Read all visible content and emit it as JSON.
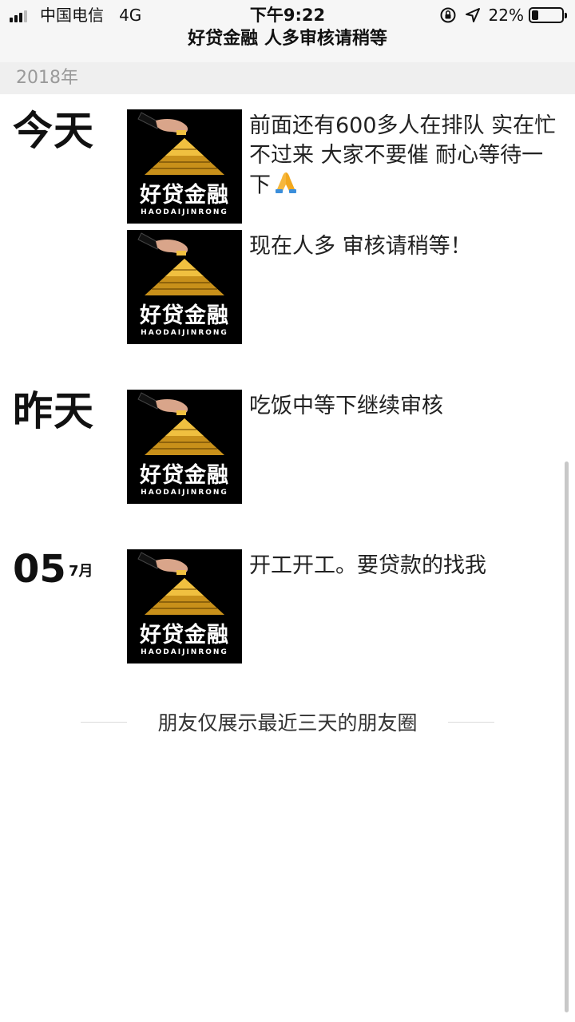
{
  "status_bar": {
    "carrier": "中国电信",
    "network": "4G",
    "time": "下午9:22",
    "battery_percent_text": "22%",
    "battery_level": 0.22,
    "icons": [
      "signal-icon",
      "orientation-lock-icon",
      "location-arrow-icon",
      "battery-icon"
    ]
  },
  "header": {
    "title": "好贷金融 人多审核请稍等"
  },
  "year_label": "2018年",
  "thumbnail": {
    "logo_cn": "好贷金融",
    "logo_en": "HAODAIJINRONG"
  },
  "days": [
    {
      "label": "今天",
      "posts": [
        {
          "text": "前面还有600多人在排队 实在忙不过来 大家不要催 耐心等待一下",
          "emoji_icon": "praying-hands-icon"
        },
        {
          "text": "现在人多 审核请稍等！"
        }
      ]
    },
    {
      "label": "昨天",
      "posts": [
        {
          "text": "吃饭中等下继续审核"
        }
      ]
    },
    {
      "day_number": "05",
      "month": "7月",
      "posts": [
        {
          "text": "开工开工。要贷款的找我"
        }
      ]
    }
  ],
  "footer_text": "朋友仅展示最近三天的朋友圈",
  "colors": {
    "header_bg": "#f6f6f6",
    "year_bar_bg": "#efefef",
    "gold": "#d9a520"
  }
}
